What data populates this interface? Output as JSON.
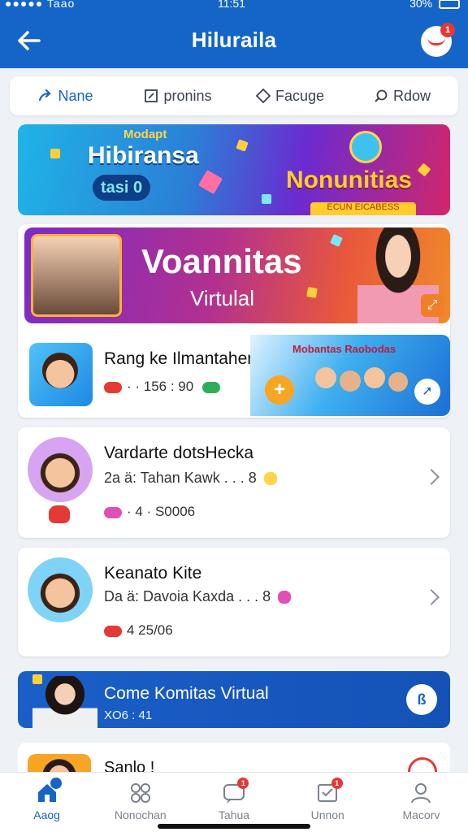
{
  "status_bar": {
    "signal": "●●●●● Taao",
    "time": "11:51",
    "battery": "30%"
  },
  "header": {
    "title": "Hiluraila",
    "notifications": "1"
  },
  "tabs": [
    {
      "label": "Nane",
      "icon": "arrow-icon",
      "active": true
    },
    {
      "label": "pronins",
      "icon": "square-icon",
      "active": false
    },
    {
      "label": "Facuge",
      "icon": "diamond-icon",
      "active": false
    },
    {
      "label": "Rdow",
      "icon": "search-icon",
      "active": false
    }
  ],
  "banner": {
    "small": "Modapt",
    "main": "Hibiransa",
    "badge": "tasi 0",
    "right": "Nonunitias",
    "strip": "ECUN EICABESS"
  },
  "promo": {
    "title": "Voannitas",
    "subtitle": "Virtulal"
  },
  "first_row": {
    "title": "Rang ke Ilmantahen",
    "meta": "· · 156 : 90",
    "side_title": "Mobantas Raobodas"
  },
  "list": [
    {
      "title": "Vardarte dotsHecka",
      "sub": "2a ä: Tahan Kawk . . . 8",
      "meta": "· 4 · S0006"
    },
    {
      "title": "Keanato Kite",
      "sub": "Da ä: Davoia Kaxda . . . 8",
      "meta": "4 25/06"
    }
  ],
  "blue_card": {
    "title": "Come Komitas Virtual",
    "sub": "XO6 : 41"
  },
  "peek": {
    "title": "Sanlo !"
  },
  "nav": [
    {
      "label": "Aaog",
      "icon": "home-icon",
      "active": true,
      "badge": ""
    },
    {
      "label": "Nonochan",
      "icon": "grid-icon",
      "active": false,
      "badge": ""
    },
    {
      "label": "Tahua",
      "icon": "chat-icon",
      "active": false,
      "badge": "1"
    },
    {
      "label": "Unnon",
      "icon": "inbox-icon",
      "active": false,
      "badge": "1"
    },
    {
      "label": "Macorv",
      "icon": "profile-icon",
      "active": false,
      "badge": ""
    }
  ],
  "colors": {
    "primary": "#1565c9",
    "accent": "#e53935",
    "background": "#eef1f6"
  }
}
